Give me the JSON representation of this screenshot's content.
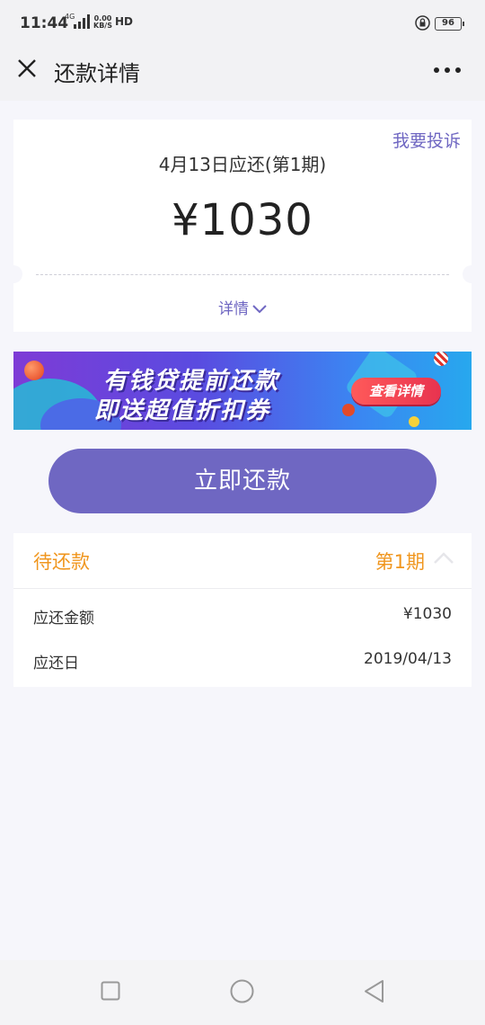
{
  "status_bar": {
    "time": "11:44",
    "network": "4G",
    "speed_value": "0.00",
    "speed_unit": "KB/S",
    "hd": "HD",
    "battery": "96"
  },
  "nav": {
    "title": "还款详情"
  },
  "bill": {
    "complaint_link": "我要投诉",
    "due_label": "4月13日应还(第1期)",
    "amount": "¥1030",
    "details_toggle": "详情"
  },
  "banner": {
    "line1": "有钱贷提前还款",
    "line2": "即送超值折扣券",
    "button": "查看详情"
  },
  "repay_button": "立即还款",
  "pending": {
    "title": "待还款",
    "period": "第1期",
    "rows": [
      {
        "label": "应还金额",
        "value": "¥1030"
      },
      {
        "label": "应还日",
        "value": "2019/04/13"
      }
    ]
  },
  "colors": {
    "accent": "#6f67c2",
    "pending_orange": "#f0961e"
  },
  "icons": [
    "close-icon",
    "more-icon",
    "chevron-down-icon",
    "chevron-up-icon",
    "square-icon",
    "circle-icon",
    "back-triangle-icon"
  ]
}
